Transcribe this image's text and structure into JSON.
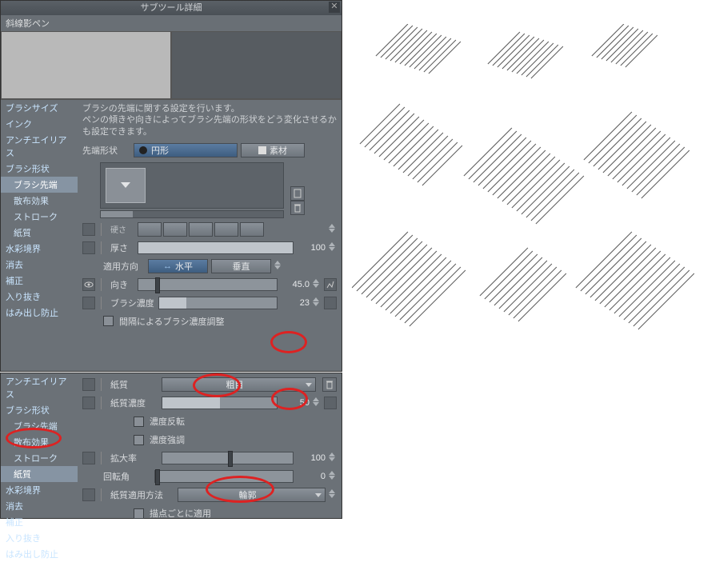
{
  "title": "サブツール詳細",
  "tool_name": "斜線影ペン",
  "description_line1": "ブラシの先端に関する設定を行います。",
  "description_line2": "ペンの傾きや向きによってブラシ先端の形状をどう変化させるかも設定できます。",
  "sidebar1": {
    "items": [
      "ブラシサイズ",
      "インク",
      "アンチエイリアス",
      "ブラシ形状",
      "ブラシ先端",
      "散布効果",
      "ストローク",
      "紙質",
      "水彩境界",
      "消去",
      "補正",
      "入り抜き",
      "はみ出し防止"
    ]
  },
  "tip_shape": {
    "label": "先端形状",
    "circle": "円形",
    "material": "素材"
  },
  "hardness": {
    "label": "硬さ"
  },
  "thickness": {
    "label": "厚さ",
    "value": "100"
  },
  "apply_dir": {
    "label": "適用方向",
    "horizontal": "水平",
    "vertical": "垂直"
  },
  "direction": {
    "label": "向き",
    "value": "45.0"
  },
  "brush_density": {
    "label": "ブラシ濃度",
    "value": "23"
  },
  "interval_adj": "間隔によるブラシ濃度調整",
  "sidebar2": {
    "items": [
      "アンチエイリアス",
      "ブラシ形状",
      "ブラシ先端",
      "散布効果",
      "ストローク",
      "紙質",
      "水彩境界",
      "消去",
      "補正",
      "入り抜き",
      "はみ出し防止"
    ]
  },
  "texture": {
    "label": "紙質",
    "value": "粗目"
  },
  "texture_density": {
    "label": "紙質濃度",
    "value": "50"
  },
  "invert_density": "濃度反転",
  "emphasize_density": "濃度強調",
  "scale": {
    "label": "拡大率",
    "value": "100"
  },
  "rotation": {
    "label": "回転角",
    "value": "0"
  },
  "apply_method": {
    "label": "紙質適用方法",
    "value": "輪郭"
  },
  "per_stroke": "描点ごとに適用"
}
